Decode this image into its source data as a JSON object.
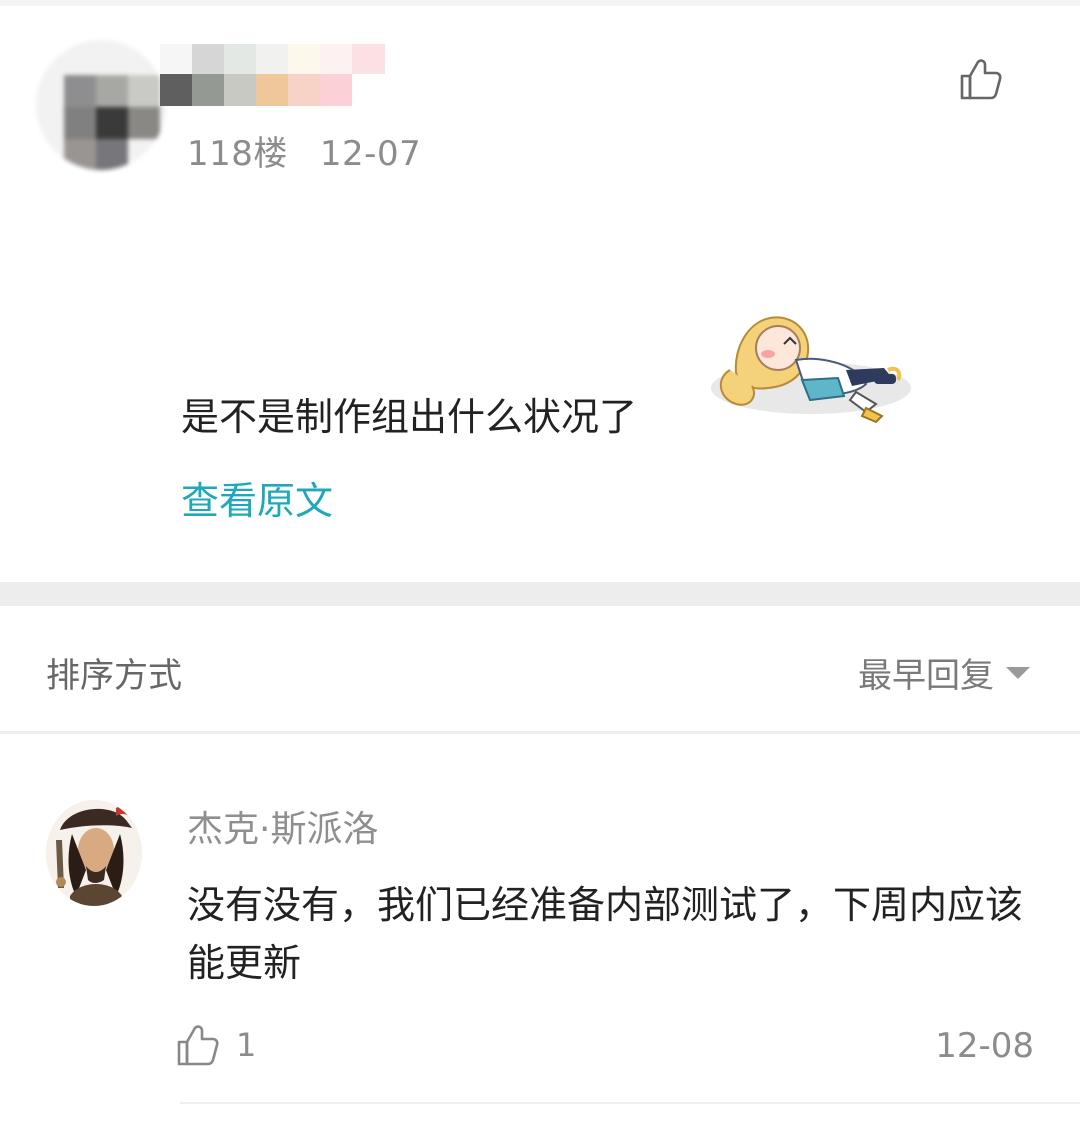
{
  "post": {
    "floor": "118楼",
    "date": "12-07",
    "text": "是不是制作组出什么状况了",
    "view_original": "查看原文",
    "like_icon": "thumbs-up-icon"
  },
  "sort": {
    "label": "排序方式",
    "selected": "最早回复"
  },
  "reply": {
    "author": "杰克·斯派洛",
    "text": "没有没有，我们已经准备内部测试了，下周内应该能更新",
    "like_count": "1",
    "date": "12-08"
  },
  "colors": {
    "link": "#1ea8b9",
    "meta": "#8c8c8c",
    "separator": "#ededed"
  }
}
